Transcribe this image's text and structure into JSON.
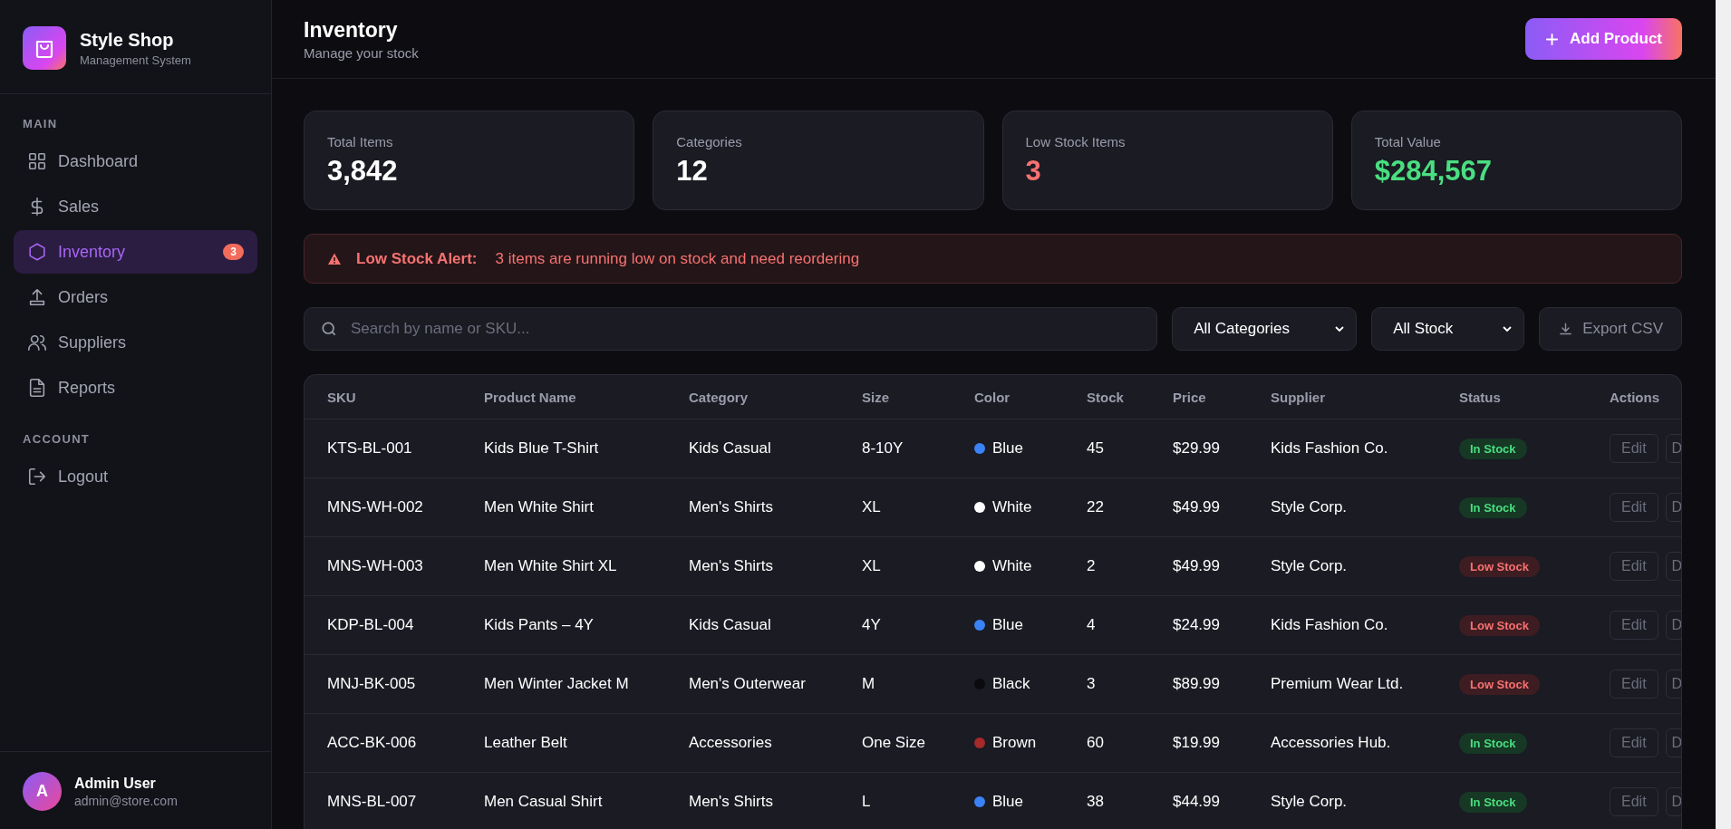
{
  "brand": {
    "name": "Style Shop",
    "subtitle": "Management System"
  },
  "sidebar": {
    "sections": [
      {
        "heading": "MAIN",
        "items": [
          {
            "label": "Dashboard",
            "selected": false
          },
          {
            "label": "Sales",
            "selected": false
          },
          {
            "label": "Inventory",
            "selected": true,
            "badge": "3"
          },
          {
            "label": "Orders",
            "selected": false
          },
          {
            "label": "Suppliers",
            "selected": false
          },
          {
            "label": "Reports",
            "selected": false
          }
        ]
      },
      {
        "heading": "ACCOUNT",
        "items": [
          {
            "label": "Logout",
            "selected": false
          }
        ]
      }
    ]
  },
  "user": {
    "initial": "A",
    "name": "Admin User",
    "email": "admin@store.com"
  },
  "header": {
    "title": "Inventory",
    "subtitle": "Manage your stock",
    "action": "Add Product"
  },
  "stats": [
    {
      "label": "Total Items",
      "value": "3,842",
      "color": "#ffffff"
    },
    {
      "label": "Categories",
      "value": "12",
      "color": "#ffffff"
    },
    {
      "label": "Low Stock Items",
      "value": "3",
      "color": "#f87171"
    },
    {
      "label": "Total Value",
      "value": "$284,567",
      "color": "#4ade80"
    }
  ],
  "alert": {
    "title": "Low Stock Alert:",
    "message": "3 items are running low on stock and need reordering"
  },
  "filters": {
    "search_placeholder": "Search by name or SKU...",
    "category": "All Categories",
    "stock": "All Stock",
    "export": "Export CSV"
  },
  "table": {
    "columns": [
      "SKU",
      "Product Name",
      "Category",
      "Size",
      "Color",
      "Stock",
      "Price",
      "Supplier",
      "Status",
      "Actions"
    ],
    "rows": [
      {
        "sku": "KTS-BL-001",
        "name": "Kids Blue T-Shirt",
        "category": "Kids Casual",
        "size": "8-10Y",
        "color_name": "Blue",
        "color": "#3b82f6",
        "stock": "45",
        "price": "$29.99",
        "supplier": "Kids Fashion Co.",
        "status": "In Stock",
        "kind": "in",
        "actions": [
          "Edit",
          "D"
        ]
      },
      {
        "sku": "MNS-WH-002",
        "name": "Men White Shirt",
        "category": "Men's Shirts",
        "size": "XL",
        "color_name": "White",
        "color": "#ffffff",
        "stock": "22",
        "price": "$49.99",
        "supplier": "Style Corp.",
        "status": "In Stock",
        "kind": "in",
        "actions": [
          "Edit",
          "D"
        ]
      },
      {
        "sku": "MNS-WH-003",
        "name": "Men White Shirt XL",
        "category": "Men's Shirts",
        "size": "XL",
        "color_name": "White",
        "color": "#ffffff",
        "stock": "2",
        "price": "$49.99",
        "supplier": "Style Corp.",
        "status": "Low Stock",
        "kind": "low",
        "actions": [
          "Edit",
          "D"
        ]
      },
      {
        "sku": "KDP-BL-004",
        "name": "Kids Pants – 4Y",
        "category": "Kids Casual",
        "size": "4Y",
        "color_name": "Blue",
        "color": "#3b82f6",
        "stock": "4",
        "price": "$24.99",
        "supplier": "Kids Fashion Co.",
        "status": "Low Stock",
        "kind": "low",
        "actions": [
          "Edit",
          "D"
        ]
      },
      {
        "sku": "MNJ-BK-005",
        "name": "Men Winter Jacket M",
        "category": "Men's Outerwear",
        "size": "M",
        "color_name": "Black",
        "color": "#0b0b0e",
        "stock": "3",
        "price": "$89.99",
        "supplier": "Premium Wear Ltd.",
        "status": "Low Stock",
        "kind": "low",
        "actions": [
          "Edit",
          "D"
        ]
      },
      {
        "sku": "ACC-BK-006",
        "name": "Leather Belt",
        "category": "Accessories",
        "size": "One Size",
        "color_name": "Brown",
        "color": "#a52a2a",
        "stock": "60",
        "price": "$19.99",
        "supplier": "Accessories Hub.",
        "status": "In Stock",
        "kind": "in",
        "actions": [
          "Edit",
          "D"
        ]
      },
      {
        "sku": "MNS-BL-007",
        "name": "Men Casual Shirt",
        "category": "Men's Shirts",
        "size": "L",
        "color_name": "Blue",
        "color": "#3b82f6",
        "stock": "38",
        "price": "$44.99",
        "supplier": "Style Corp.",
        "status": "In Stock",
        "kind": "in",
        "actions": [
          "Edit",
          "D"
        ]
      }
    ]
  }
}
